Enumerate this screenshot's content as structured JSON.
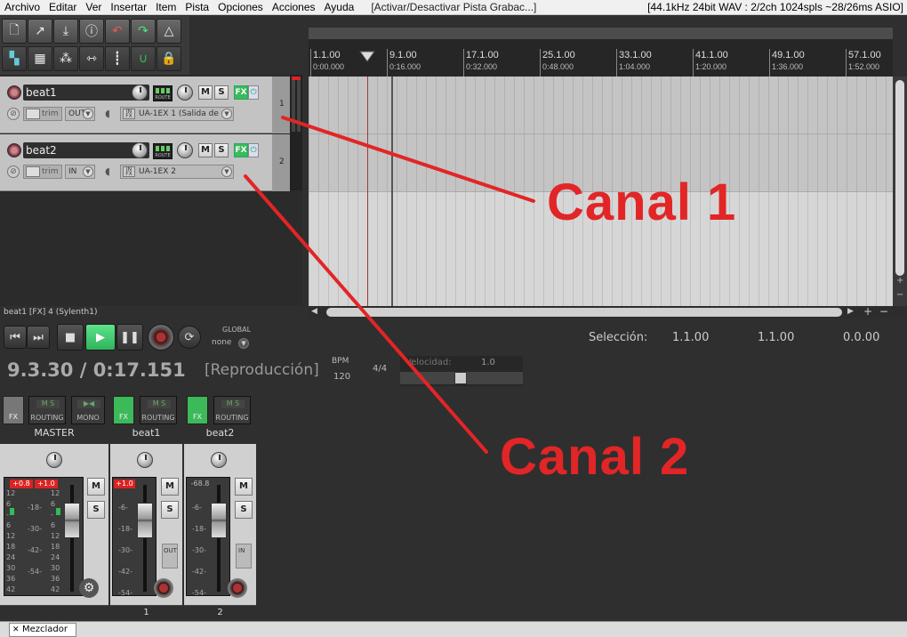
{
  "menu": {
    "items": [
      "Archivo",
      "Editar",
      "Ver",
      "Insertar",
      "Item",
      "Pista",
      "Opciones",
      "Acciones",
      "Ayuda"
    ],
    "action_text": "[Activar/Desactivar Pista Grabac...]",
    "status": "[44.1kHz 24bit WAV : 2/2ch 1024spls ~28/26ms ASIO]"
  },
  "tracks": [
    {
      "name": "beat1",
      "number": "1",
      "trim": "trim",
      "io": "OUT",
      "input": "UA-1EX 1 (Salida de",
      "fx": "FX",
      "mute": "M",
      "solo": "S",
      "route": "ROUTE"
    },
    {
      "name": "beat2",
      "number": "2",
      "trim": "trim",
      "io": "IN",
      "input": "UA-1EX 2",
      "fx": "FX",
      "mute": "M",
      "solo": "S",
      "route": "ROUTE"
    }
  ],
  "fx_status": "beat1 [FX] 4 (Sylenth1)",
  "ruler": {
    "bars": [
      "1.1.00",
      "9.1.00",
      "17.1.00",
      "25.1.00",
      "33.1.00",
      "41.1.00",
      "49.1.00",
      "57.1.00"
    ],
    "times": [
      "0:00.000",
      "0:16.000",
      "0:32.000",
      "0:48.000",
      "1:04.000",
      "1:20.000",
      "1:36.000",
      "1:52.000"
    ]
  },
  "transport": {
    "position": "9.3.30 / 0:17.151",
    "state": "[Reproducción]",
    "bpm_label": "BPM",
    "bpm": "120",
    "time_sig": "4/4",
    "rate_label": "Velocidad:",
    "rate": "1.0",
    "global_label": "GLOBAL",
    "global_value": "none",
    "selection_label": "Selección:",
    "selection_start": "1.1.00",
    "selection_end": "1.1.00",
    "selection_length": "0.0.00"
  },
  "mixer": {
    "master": {
      "label": "MASTER",
      "fx": "FX",
      "routing": "ROUTING",
      "mono": "MONO",
      "peak_l": "+0.8",
      "peak_r": "+1.0",
      "mute": "M",
      "solo": "S"
    },
    "strips": [
      {
        "label": "beat1",
        "fx": "FX",
        "routing": "ROUTING",
        "peak": "+1.0",
        "mute": "M",
        "solo": "S",
        "io": "OUT",
        "number": "1"
      },
      {
        "label": "beat2",
        "fx": "FX",
        "routing": "ROUTING",
        "peak": "-68.8",
        "mute": "M",
        "solo": "S",
        "io": "IN",
        "number": "2"
      }
    ],
    "scale_master": [
      "12",
      "6",
      "-",
      "6",
      "12",
      "18",
      "24",
      "30",
      "36",
      "42",
      "54"
    ],
    "scale_center": [
      "-6-",
      "-18-",
      "-30-",
      "-42-",
      "-54-"
    ]
  },
  "tab": {
    "label": "Mezclador"
  },
  "annotations": {
    "canal1": "Canal 1",
    "canal2": "Canal 2",
    "color": "#e22526"
  }
}
